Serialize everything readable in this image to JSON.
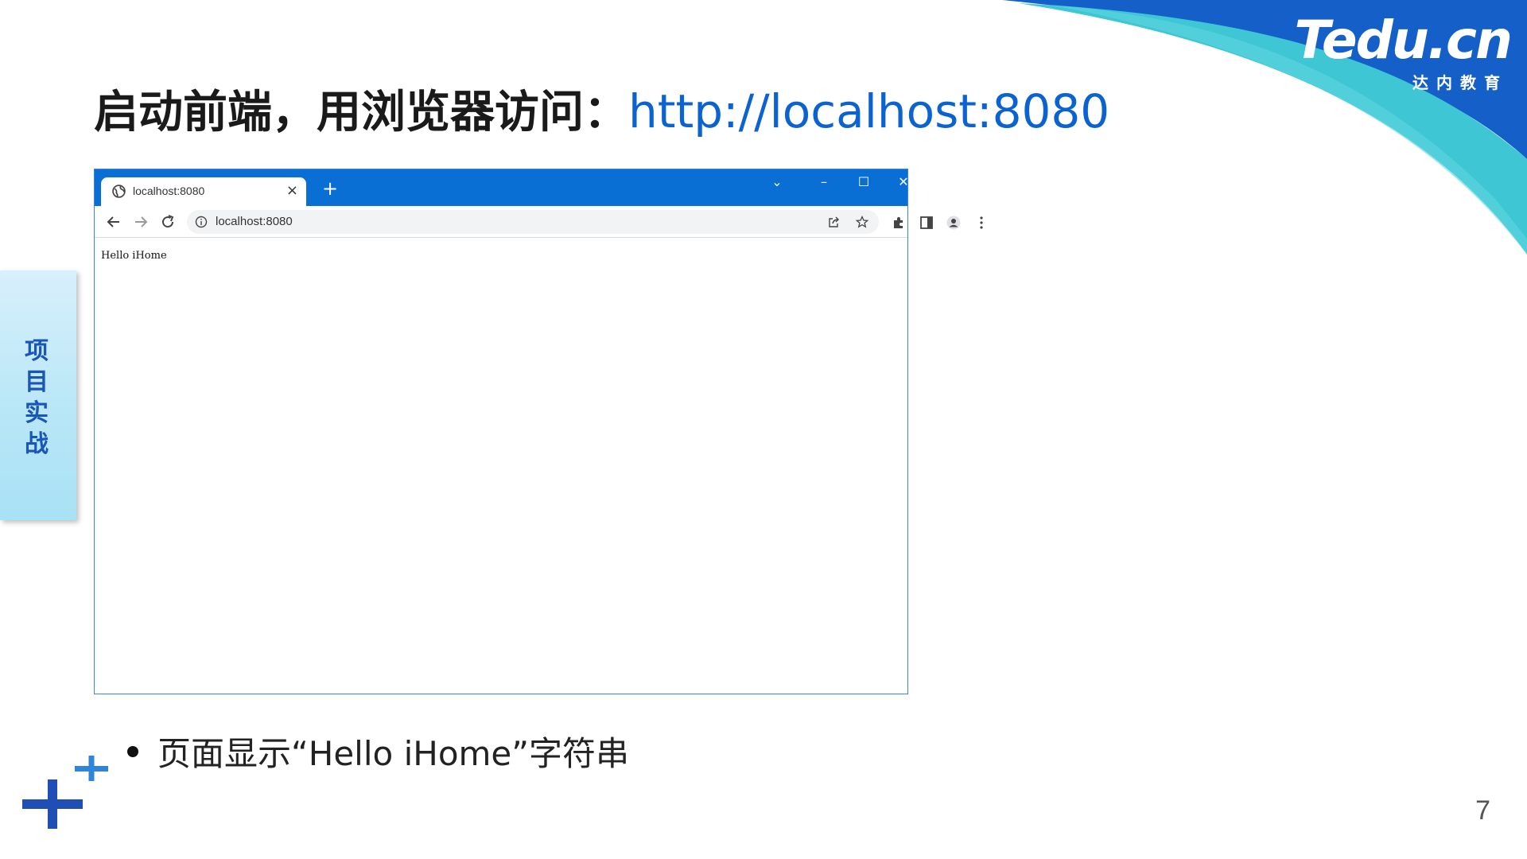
{
  "brand": {
    "logo_text": "Tedu.cn",
    "logo_subtext": "达内教育"
  },
  "slide": {
    "title_cn": "启动前端，用浏览器访问：",
    "title_url": "http://localhost:8080",
    "section_label": "项目实战",
    "bullet_text": "页面显示“Hello iHome”字符串",
    "page_number": "7"
  },
  "browser": {
    "tab_title": "localhost:8080",
    "tab_close": "×",
    "new_tab": "+",
    "tab_search": "⌄",
    "minimize": "–",
    "maximize": "☐",
    "close": "✕",
    "url": "localhost:8080",
    "page_content": "Hello iHome",
    "colors": {
      "titlebar": "#0a6fd4",
      "border": "#3b86d6"
    }
  },
  "icons": [
    "globe-icon",
    "back-arrow-icon",
    "forward-arrow-icon",
    "reload-icon",
    "info-icon",
    "share-icon",
    "star-icon",
    "extensions-icon",
    "side-panel-icon",
    "profile-icon",
    "menu-dots-icon",
    "plus-icon"
  ],
  "colors": {
    "title_url": "#0b63d1",
    "side_label": "#1a56b8",
    "swoosh_dark": "#1460c8",
    "swoosh_light": "#3ec6d4"
  }
}
